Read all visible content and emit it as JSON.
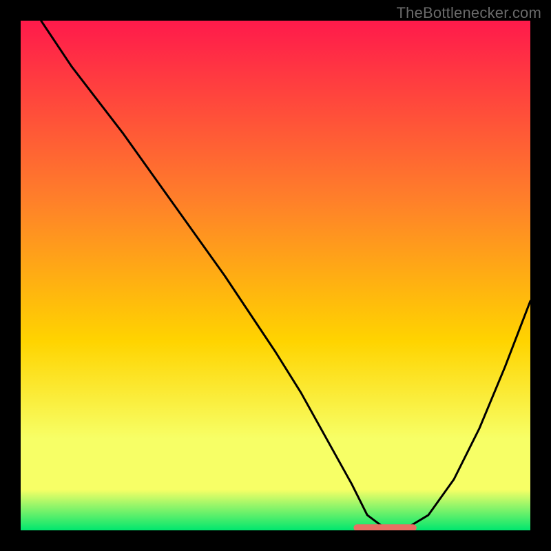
{
  "watermark": "TheBottlenecker.com",
  "colors": {
    "top": "#ff1a4b",
    "mid_high": "#ff7f2a",
    "mid": "#ffd400",
    "low": "#f7ff66",
    "bottom": "#00e66e",
    "curve": "#000000",
    "marker": "#e86f63",
    "background": "#000000"
  },
  "chart_data": {
    "type": "line",
    "title": "",
    "xlabel": "",
    "ylabel": "",
    "xlim": [
      0,
      100
    ],
    "ylim": [
      0,
      100
    ],
    "series": [
      {
        "name": "curve",
        "x": [
          4,
          10,
          20,
          30,
          40,
          50,
          55,
          60,
          65,
          68,
          72,
          75,
          80,
          85,
          90,
          95,
          100
        ],
        "y": [
          100,
          91,
          78,
          64,
          50,
          35,
          27,
          18,
          9,
          3,
          0,
          0,
          3,
          10,
          20,
          32,
          45
        ]
      },
      {
        "name": "marker-band",
        "x": [
          66,
          77
        ],
        "y": [
          0.5,
          0.5
        ]
      }
    ]
  }
}
